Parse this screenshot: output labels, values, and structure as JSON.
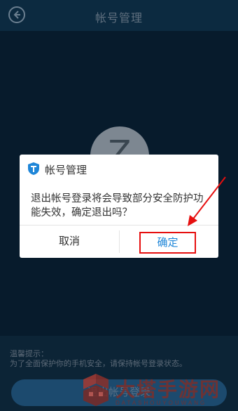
{
  "header": {
    "title": "帐号管理",
    "back_icon": "chevron-left-icon"
  },
  "avatar": {
    "glyph": "Z"
  },
  "tips": {
    "title": "温馨提示：",
    "text": "为了全面保护你的手机安全，请保持帐号登录状态。"
  },
  "bottom_button": {
    "label": "退出帐号登录"
  },
  "dialog": {
    "icon": "shield-icon",
    "title": "帐号管理",
    "message": "退出帐号登录将会导致部分安全防护功能失效，确定退出吗？",
    "cancel_label": "取消",
    "ok_label": "确定"
  },
  "watermark": {
    "text": "大塔手游网",
    "subtext": "DATASHOUYOUWANG"
  },
  "colors": {
    "background": "#071b2c",
    "dialog_bg": "#ffffff",
    "accent_blue": "#1f86d8",
    "highlight_red": "#e60f0f"
  }
}
